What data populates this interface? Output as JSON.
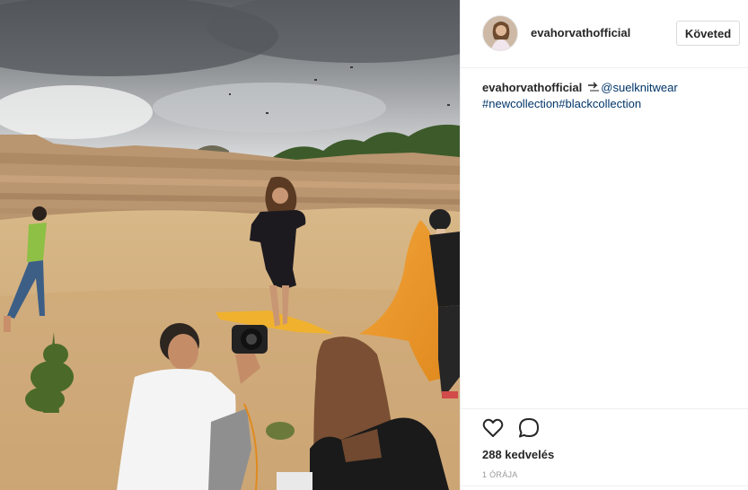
{
  "post": {
    "username": "evahorvathofficial",
    "follow_label": "Követed",
    "caption": {
      "username": "evahorvathofficial",
      "mention": "@suelknitwear",
      "hashtags": [
        "#newcollection",
        "#blackcollection"
      ]
    },
    "likes_text": "288 kedvelés",
    "timestamp": "1 ÓRÁJA"
  },
  "icons": {
    "like": "heart-icon",
    "comment": "comment-bubble-icon",
    "caption_arrow": "arrow-share-icon"
  },
  "colors": {
    "text": "#262626",
    "link": "#003569",
    "muted": "#999999",
    "border": "#efefef"
  }
}
